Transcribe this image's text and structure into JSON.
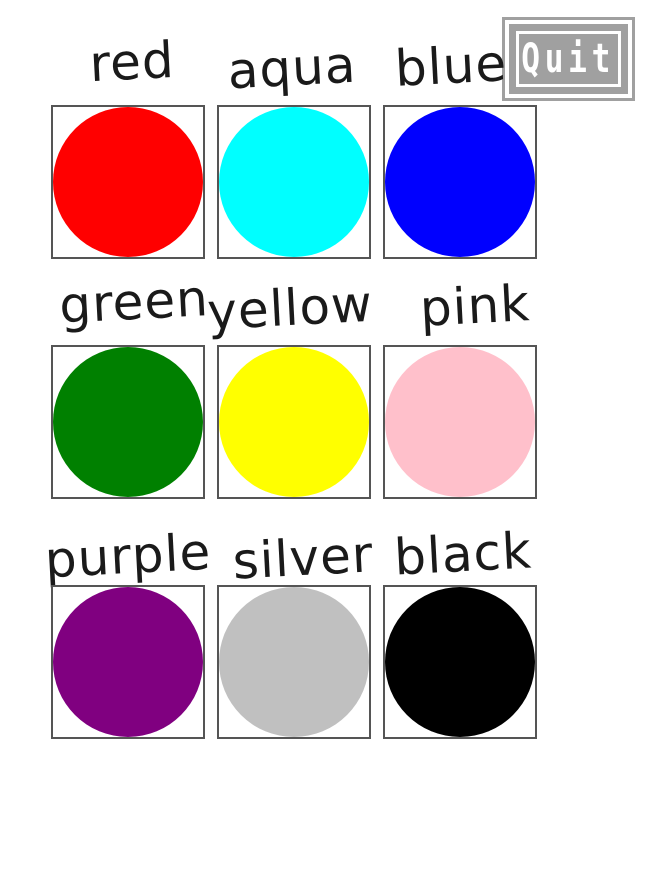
{
  "quit_button": {
    "label": "Quit"
  },
  "colors": [
    {
      "label": "red",
      "hex": "#ff0000"
    },
    {
      "label": "aqua",
      "hex": "#00ffff"
    },
    {
      "label": "blue",
      "hex": "#0000ff"
    },
    {
      "label": "green",
      "hex": "#008000"
    },
    {
      "label": "yellow",
      "hex": "#ffff00"
    },
    {
      "label": "pink",
      "hex": "#ffc0cb"
    },
    {
      "label": "purple",
      "hex": "#800080"
    },
    {
      "label": "silver",
      "hex": "#c0c0c0"
    },
    {
      "label": "black",
      "hex": "#000000"
    }
  ]
}
